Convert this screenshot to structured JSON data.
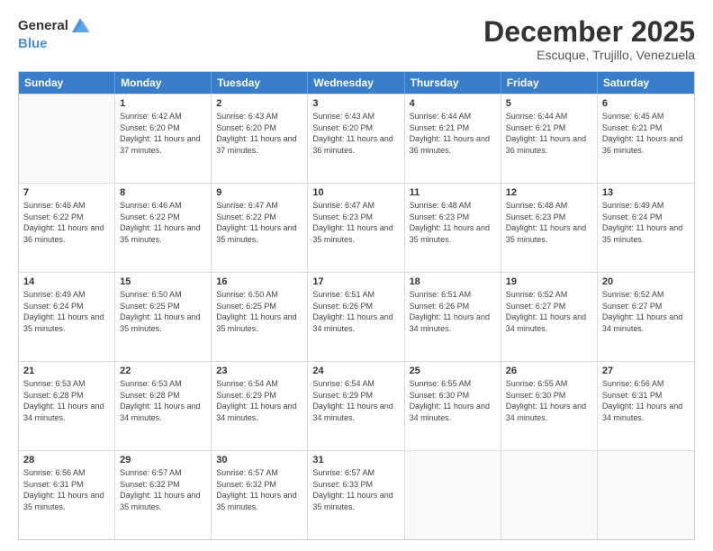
{
  "header": {
    "logo_general": "General",
    "logo_blue": "Blue",
    "month_title": "December 2025",
    "subtitle": "Escuque, Trujillo, Venezuela"
  },
  "calendar": {
    "days_of_week": [
      "Sunday",
      "Monday",
      "Tuesday",
      "Wednesday",
      "Thursday",
      "Friday",
      "Saturday"
    ],
    "weeks": [
      [
        {
          "day": "",
          "sunrise": "",
          "sunset": "",
          "daylight": ""
        },
        {
          "day": "1",
          "sunrise": "Sunrise: 6:42 AM",
          "sunset": "Sunset: 6:20 PM",
          "daylight": "Daylight: 11 hours and 37 minutes."
        },
        {
          "day": "2",
          "sunrise": "Sunrise: 6:43 AM",
          "sunset": "Sunset: 6:20 PM",
          "daylight": "Daylight: 11 hours and 37 minutes."
        },
        {
          "day": "3",
          "sunrise": "Sunrise: 6:43 AM",
          "sunset": "Sunset: 6:20 PM",
          "daylight": "Daylight: 11 hours and 36 minutes."
        },
        {
          "day": "4",
          "sunrise": "Sunrise: 6:44 AM",
          "sunset": "Sunset: 6:21 PM",
          "daylight": "Daylight: 11 hours and 36 minutes."
        },
        {
          "day": "5",
          "sunrise": "Sunrise: 6:44 AM",
          "sunset": "Sunset: 6:21 PM",
          "daylight": "Daylight: 11 hours and 36 minutes."
        },
        {
          "day": "6",
          "sunrise": "Sunrise: 6:45 AM",
          "sunset": "Sunset: 6:21 PM",
          "daylight": "Daylight: 11 hours and 36 minutes."
        }
      ],
      [
        {
          "day": "7",
          "sunrise": "Sunrise: 6:46 AM",
          "sunset": "Sunset: 6:22 PM",
          "daylight": "Daylight: 11 hours and 36 minutes."
        },
        {
          "day": "8",
          "sunrise": "Sunrise: 6:46 AM",
          "sunset": "Sunset: 6:22 PM",
          "daylight": "Daylight: 11 hours and 35 minutes."
        },
        {
          "day": "9",
          "sunrise": "Sunrise: 6:47 AM",
          "sunset": "Sunset: 6:22 PM",
          "daylight": "Daylight: 11 hours and 35 minutes."
        },
        {
          "day": "10",
          "sunrise": "Sunrise: 6:47 AM",
          "sunset": "Sunset: 6:23 PM",
          "daylight": "Daylight: 11 hours and 35 minutes."
        },
        {
          "day": "11",
          "sunrise": "Sunrise: 6:48 AM",
          "sunset": "Sunset: 6:23 PM",
          "daylight": "Daylight: 11 hours and 35 minutes."
        },
        {
          "day": "12",
          "sunrise": "Sunrise: 6:48 AM",
          "sunset": "Sunset: 6:23 PM",
          "daylight": "Daylight: 11 hours and 35 minutes."
        },
        {
          "day": "13",
          "sunrise": "Sunrise: 6:49 AM",
          "sunset": "Sunset: 6:24 PM",
          "daylight": "Daylight: 11 hours and 35 minutes."
        }
      ],
      [
        {
          "day": "14",
          "sunrise": "Sunrise: 6:49 AM",
          "sunset": "Sunset: 6:24 PM",
          "daylight": "Daylight: 11 hours and 35 minutes."
        },
        {
          "day": "15",
          "sunrise": "Sunrise: 6:50 AM",
          "sunset": "Sunset: 6:25 PM",
          "daylight": "Daylight: 11 hours and 35 minutes."
        },
        {
          "day": "16",
          "sunrise": "Sunrise: 6:50 AM",
          "sunset": "Sunset: 6:25 PM",
          "daylight": "Daylight: 11 hours and 35 minutes."
        },
        {
          "day": "17",
          "sunrise": "Sunrise: 6:51 AM",
          "sunset": "Sunset: 6:26 PM",
          "daylight": "Daylight: 11 hours and 34 minutes."
        },
        {
          "day": "18",
          "sunrise": "Sunrise: 6:51 AM",
          "sunset": "Sunset: 6:26 PM",
          "daylight": "Daylight: 11 hours and 34 minutes."
        },
        {
          "day": "19",
          "sunrise": "Sunrise: 6:52 AM",
          "sunset": "Sunset: 6:27 PM",
          "daylight": "Daylight: 11 hours and 34 minutes."
        },
        {
          "day": "20",
          "sunrise": "Sunrise: 6:52 AM",
          "sunset": "Sunset: 6:27 PM",
          "daylight": "Daylight: 11 hours and 34 minutes."
        }
      ],
      [
        {
          "day": "21",
          "sunrise": "Sunrise: 6:53 AM",
          "sunset": "Sunset: 6:28 PM",
          "daylight": "Daylight: 11 hours and 34 minutes."
        },
        {
          "day": "22",
          "sunrise": "Sunrise: 6:53 AM",
          "sunset": "Sunset: 6:28 PM",
          "daylight": "Daylight: 11 hours and 34 minutes."
        },
        {
          "day": "23",
          "sunrise": "Sunrise: 6:54 AM",
          "sunset": "Sunset: 6:29 PM",
          "daylight": "Daylight: 11 hours and 34 minutes."
        },
        {
          "day": "24",
          "sunrise": "Sunrise: 6:54 AM",
          "sunset": "Sunset: 6:29 PM",
          "daylight": "Daylight: 11 hours and 34 minutes."
        },
        {
          "day": "25",
          "sunrise": "Sunrise: 6:55 AM",
          "sunset": "Sunset: 6:30 PM",
          "daylight": "Daylight: 11 hours and 34 minutes."
        },
        {
          "day": "26",
          "sunrise": "Sunrise: 6:55 AM",
          "sunset": "Sunset: 6:30 PM",
          "daylight": "Daylight: 11 hours and 34 minutes."
        },
        {
          "day": "27",
          "sunrise": "Sunrise: 6:56 AM",
          "sunset": "Sunset: 6:31 PM",
          "daylight": "Daylight: 11 hours and 34 minutes."
        }
      ],
      [
        {
          "day": "28",
          "sunrise": "Sunrise: 6:56 AM",
          "sunset": "Sunset: 6:31 PM",
          "daylight": "Daylight: 11 hours and 35 minutes."
        },
        {
          "day": "29",
          "sunrise": "Sunrise: 6:57 AM",
          "sunset": "Sunset: 6:32 PM",
          "daylight": "Daylight: 11 hours and 35 minutes."
        },
        {
          "day": "30",
          "sunrise": "Sunrise: 6:57 AM",
          "sunset": "Sunset: 6:32 PM",
          "daylight": "Daylight: 11 hours and 35 minutes."
        },
        {
          "day": "31",
          "sunrise": "Sunrise: 6:57 AM",
          "sunset": "Sunset: 6:33 PM",
          "daylight": "Daylight: 11 hours and 35 minutes."
        },
        {
          "day": "",
          "sunrise": "",
          "sunset": "",
          "daylight": ""
        },
        {
          "day": "",
          "sunrise": "",
          "sunset": "",
          "daylight": ""
        },
        {
          "day": "",
          "sunrise": "",
          "sunset": "",
          "daylight": ""
        }
      ]
    ]
  }
}
